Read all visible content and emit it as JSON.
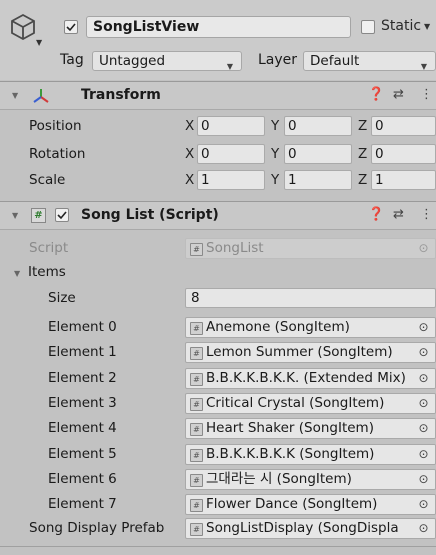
{
  "gameobject": {
    "name": "SongListView",
    "active": true,
    "static_label": "Static",
    "tag_label": "Tag",
    "tag_value": "Untagged",
    "layer_label": "Layer",
    "layer_value": "Default"
  },
  "transform": {
    "title": "Transform",
    "rows": [
      {
        "label": "Position",
        "x": "0",
        "y": "0",
        "z": "0"
      },
      {
        "label": "Rotation",
        "x": "0",
        "y": "0",
        "z": "0"
      },
      {
        "label": "Scale",
        "x": "1",
        "y": "1",
        "z": "1"
      }
    ],
    "axis_x": "X",
    "axis_y": "Y",
    "axis_z": "Z"
  },
  "songlist": {
    "title": "Song List (Script)",
    "enabled": true,
    "script_label": "Script",
    "script_value": "SongList",
    "items_label": "Items",
    "size_label": "Size",
    "size_value": "8",
    "elements": [
      {
        "label": "Element 0",
        "value": "Anemone (SongItem)"
      },
      {
        "label": "Element 1",
        "value": "Lemon Summer (SongItem)"
      },
      {
        "label": "Element 2",
        "value": "B.B.K.K.B.K.K. (Extended Mix)"
      },
      {
        "label": "Element 3",
        "value": "Critical Crystal (SongItem)"
      },
      {
        "label": "Element 4",
        "value": "Heart Shaker (SongItem)"
      },
      {
        "label": "Element 5",
        "value": "B.B.K.K.B.K.K (SongItem)"
      },
      {
        "label": "Element 6",
        "value": "그대라는 시 (SongItem)"
      },
      {
        "label": "Element 7",
        "value": "Flower Dance (SongItem)"
      }
    ],
    "prefab_label": "Song Display Prefab",
    "prefab_value": "SongListDisplay (SongDispla"
  },
  "icons": {
    "gameobject": "cube-icon",
    "transform": "transform-axes-icon",
    "script": "script-hash-icon",
    "help": "help-icon",
    "presets": "presets-icon",
    "menu": "kebab-menu-icon",
    "picker": "object-picker-icon"
  }
}
